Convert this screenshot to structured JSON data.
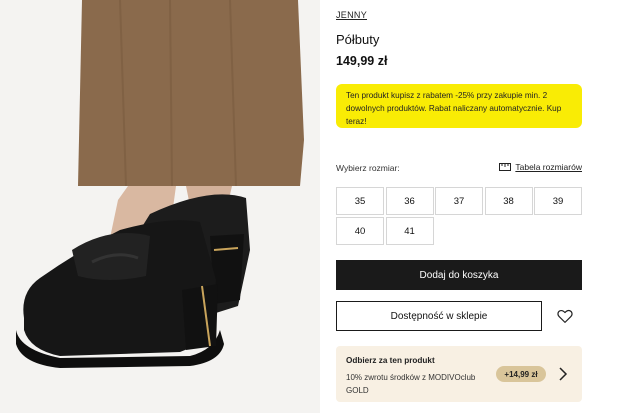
{
  "product": {
    "brand": "JENNY",
    "title": "Półbuty",
    "price": "149,99 zł"
  },
  "promo": {
    "text": "Ten produkt kupisz z rabatem -25% przy zakupie min. 2 dowolnych produktów. Rabat naliczany automatycznie. Kup teraz!"
  },
  "sizes": {
    "label": "Wybierz rozmiar:",
    "table_link": "Tabela rozmiarów",
    "options": [
      "35",
      "36",
      "37",
      "38",
      "39",
      "40",
      "41"
    ]
  },
  "actions": {
    "add_to_cart": "Dodaj do koszyka",
    "store_availability": "Dostępność w sklepie"
  },
  "reward": {
    "title": "Odbierz za ten produkt",
    "description": "10% zwrotu środków z MODIVOclub GOLD",
    "amount": "+14,99 zł"
  },
  "icons": {
    "size_table": "ruler-icon",
    "wishlist": "heart-icon",
    "reward_more": "chevron-right-icon"
  },
  "colors": {
    "promo_bg": "#f9ec05",
    "primary_button": "#1a1a1a",
    "reward_bg": "#f8f0e3",
    "reward_badge": "#d9c59a"
  }
}
